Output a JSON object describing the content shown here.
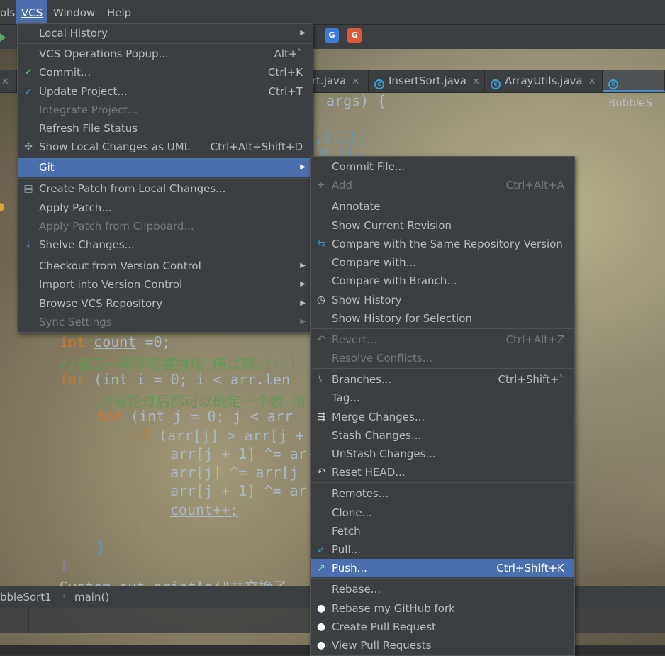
{
  "menubar": {
    "items": [
      {
        "label": "ols",
        "active": false
      },
      {
        "label": "VCS",
        "active": true
      },
      {
        "label": "Window",
        "active": false
      },
      {
        "label": "Help",
        "active": false
      }
    ]
  },
  "tabs": [
    {
      "label": "rt.java"
    },
    {
      "label": "InsertSort.java"
    },
    {
      "label": "ArrayUtils.java"
    },
    {
      "label": "BubbleS"
    }
  ],
  "code_fragments": {
    "args": "args) {",
    "arr1": ",9,1};",
    "arr2": "9,1};",
    "count_kw": "int",
    "count_var": "count",
    "count_rest": "=0;",
    "comment1": "//最后一轮不需要排序 所以到arr.l",
    "for1_kw": "for",
    "for1_rest": "(int i = 0; i < arr.len",
    "comment2": "//每轮过后都可以确定一个数 所",
    "for2_kw": "for",
    "for2_rest": "(int j = 0; j < arr",
    "if_kw": "if",
    "if_rest": "(arr[j] > arr[j +",
    "line_a": "arr[j + 1] ^= ar",
    "line_b": "arr[j] ^= arr[j",
    "line_c": "arr[j + 1] ^= ar",
    "count_inc": "count++;",
    "brace1": "}",
    "brace2": "}",
    "brace3": "}",
    "sysout": "System.out.println(\"共交换了"
  },
  "breadcrumb": {
    "file": "bbleSort1",
    "method": "main()"
  },
  "vcs_menu": {
    "items": [
      {
        "label": "Local History",
        "submenu": true
      },
      {
        "label": "VCS Operations Popup...",
        "shortcut": "Alt+`"
      },
      {
        "label": "Commit...",
        "shortcut": "Ctrl+K",
        "icon": "check-icon"
      },
      {
        "label": "Update Project...",
        "shortcut": "Ctrl+T",
        "icon": "update-arrow-icon"
      },
      {
        "label": "Integrate Project...",
        "disabled": true
      },
      {
        "label": "Refresh File Status"
      },
      {
        "label": "Show Local Changes as UML",
        "shortcut": "Ctrl+Alt+Shift+D",
        "icon": "uml-icon"
      },
      {
        "label": "Git",
        "submenu": true,
        "highlighted": true
      },
      {
        "label": "Create Patch from Local Changes...",
        "icon": "patch-icon"
      },
      {
        "label": "Apply Patch..."
      },
      {
        "label": "Apply Patch from Clipboard...",
        "disabled": true
      },
      {
        "label": "Shelve Changes...",
        "icon": "shelve-icon"
      },
      {
        "label": "Checkout from Version Control",
        "submenu": true
      },
      {
        "label": "Import into Version Control",
        "submenu": true
      },
      {
        "label": "Browse VCS Repository",
        "submenu": true
      },
      {
        "label": "Sync Settings",
        "submenu": true,
        "disabled": true
      }
    ]
  },
  "git_menu": {
    "items": [
      {
        "label": "Commit File..."
      },
      {
        "label": "Add",
        "shortcut": "Ctrl+Alt+A",
        "disabled": true,
        "icon": "plus-icon"
      },
      {
        "label": "Annotate"
      },
      {
        "label": "Show Current Revision"
      },
      {
        "label": "Compare with the Same Repository Version",
        "icon": "compare-icon"
      },
      {
        "label": "Compare with..."
      },
      {
        "label": "Compare with Branch..."
      },
      {
        "label": "Show History",
        "icon": "clock-icon"
      },
      {
        "label": "Show History for Selection"
      },
      {
        "label": "Revert...",
        "shortcut": "Ctrl+Alt+Z",
        "disabled": true,
        "icon": "revert-icon"
      },
      {
        "label": "Resolve Conflicts...",
        "disabled": true
      },
      {
        "label": "Branches...",
        "shortcut": "Ctrl+Shift+`",
        "icon": "branch-icon"
      },
      {
        "label": "Tag..."
      },
      {
        "label": "Merge Changes...",
        "icon": "merge-icon"
      },
      {
        "label": "Stash Changes..."
      },
      {
        "label": "UnStash Changes..."
      },
      {
        "label": "Reset HEAD...",
        "icon": "reset-icon"
      },
      {
        "label": "Remotes..."
      },
      {
        "label": "Clone..."
      },
      {
        "label": "Fetch"
      },
      {
        "label": "Pull...",
        "icon": "pull-icon"
      },
      {
        "label": "Push...",
        "shortcut": "Ctrl+Shift+K",
        "highlighted": true,
        "icon": "push-icon"
      },
      {
        "label": "Rebase..."
      },
      {
        "label": "Rebase my GitHub fork",
        "icon": "github-icon"
      },
      {
        "label": "Create Pull Request",
        "icon": "github-icon"
      },
      {
        "label": "View Pull Requests",
        "icon": "github-icon"
      }
    ]
  },
  "toolbar": {
    "translate1": "G",
    "translate2": "G"
  },
  "colors": {
    "highlight": "#4b6eaf",
    "menu_bg": "#3c3f41"
  }
}
